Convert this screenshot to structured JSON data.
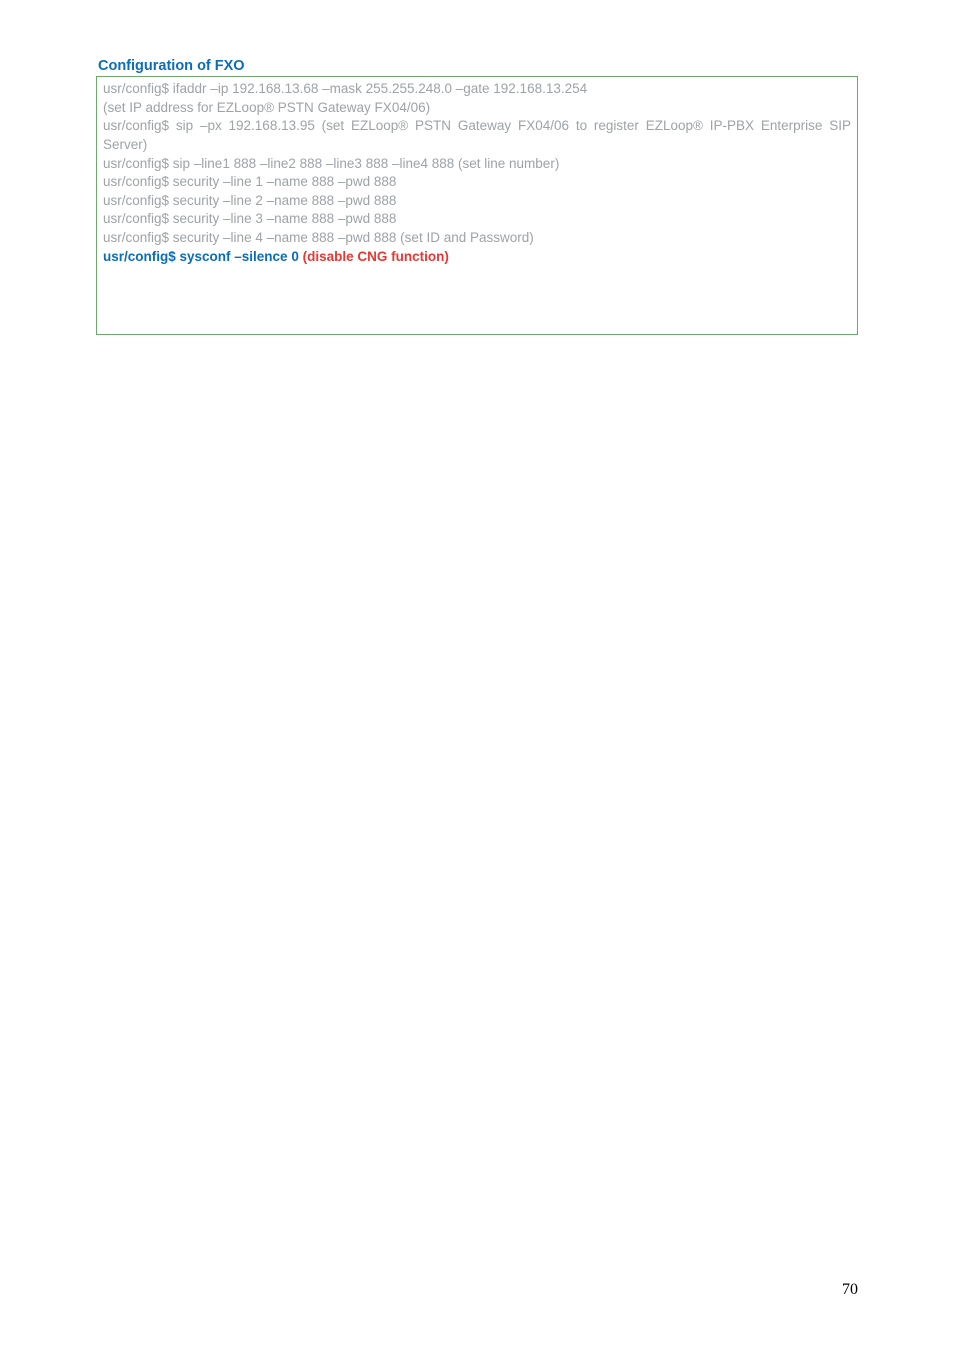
{
  "heading": "Configuration of FXO",
  "cfg": {
    "l1": "usr/config$ ifaddr –ip 192.168.13.68 –mask 255.255.248.0 –gate 192.168.13.254",
    "l2": "(set IP address for EZLoop® PSTN Gateway FX04/06)",
    "l3": "usr/config$ sip –px 192.168.13.95 (set EZLoop® PSTN Gateway FX04/06 to register EZLoop® IP-PBX Enterprise SIP Server)",
    "l4": "usr/config$ sip –line1 888 –line2 888 –line3 888 –line4 888 (set line number)",
    "l5": "usr/config$ security –line 1 –name 888 –pwd 888",
    "l6": "usr/config$ security –line 2 –name 888 –pwd 888",
    "l7": "usr/config$ security –line 3 –name 888 –pwd 888",
    "l8": "usr/config$ security –line 4 –name 888 –pwd 888 (set ID and Password)",
    "em": "usr/config$ sysconf –silence 0 ",
    "red": "(disable CNG function)"
  },
  "pageNumber": "70"
}
